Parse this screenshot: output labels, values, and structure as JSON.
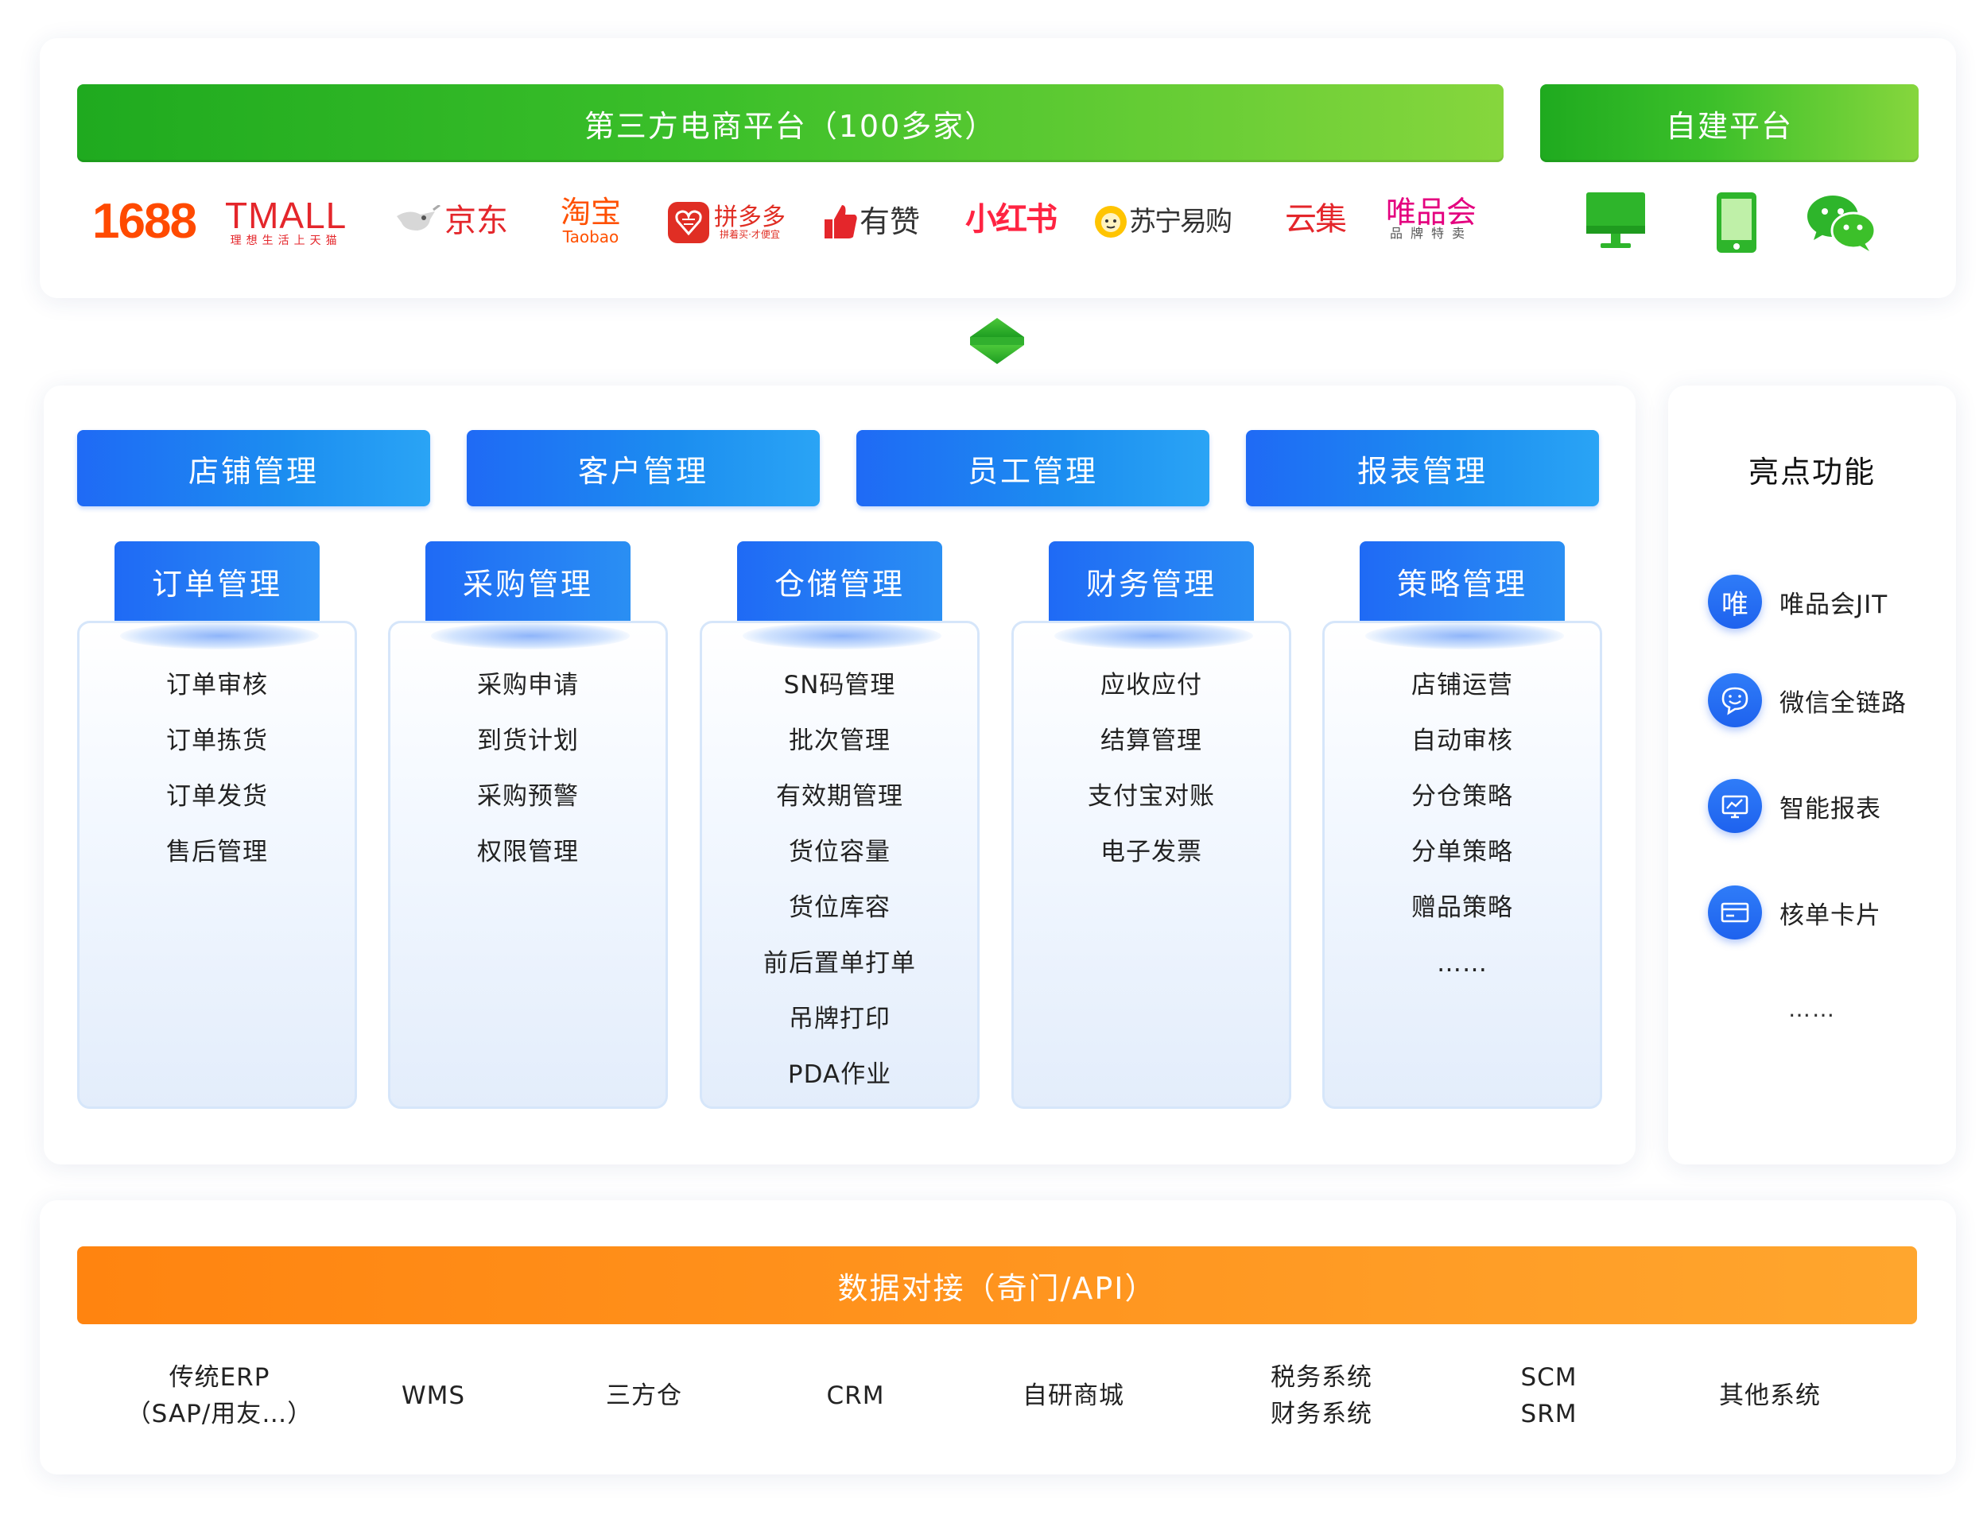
{
  "top": {
    "third_party_title": "第三方电商平台（100多家）",
    "self_built_title": "自建平台",
    "logos": {
      "l1688": "1688",
      "tmall": "TMALL",
      "tmall_sub": "理想生活上天猫",
      "jd": "京东",
      "taobao_cn": "淘宝",
      "taobao_en": "Taobao",
      "pdd": "拼多多",
      "pdd_sub": "拼着买·才便宜",
      "youzan": "有赞",
      "xhs": "小红书",
      "suning": "苏宁易购",
      "yunji": "云集",
      "vip": "唯品会",
      "vip_sub": "品牌特卖"
    },
    "self_icons": [
      "monitor-icon",
      "phone-icon",
      "wechat-icon"
    ]
  },
  "modules": {
    "top_row": [
      "店铺管理",
      "客户管理",
      "员工管理",
      "报表管理"
    ],
    "columns": [
      {
        "title": "订单管理",
        "items": [
          "订单审核",
          "订单拣货",
          "订单发货",
          "售后管理"
        ]
      },
      {
        "title": "采购管理",
        "items": [
          "采购申请",
          "到货计划",
          "采购预警",
          "权限管理"
        ]
      },
      {
        "title": "仓储管理",
        "items": [
          "SN码管理",
          "批次管理",
          "有效期管理",
          "货位容量",
          "货位库容",
          "前后置单打单",
          "吊牌打印",
          "PDA作业"
        ]
      },
      {
        "title": "财务管理",
        "items": [
          "应收应付",
          "结算管理",
          "支付宝对账",
          "电子发票"
        ]
      },
      {
        "title": "策略管理",
        "items": [
          "店铺运营",
          "自动审核",
          "分仓策略",
          "分单策略",
          "赠品策略",
          "……"
        ]
      }
    ]
  },
  "highlights": {
    "title": "亮点功能",
    "items": [
      {
        "label": "唯品会JIT",
        "icon": "vip-icon",
        "glyph": "唯"
      },
      {
        "label": "微信全链路",
        "icon": "chat-icon"
      },
      {
        "label": "智能报表",
        "icon": "report-icon"
      },
      {
        "label": "核单卡片",
        "icon": "card-icon"
      }
    ],
    "ellipsis": "……"
  },
  "bottom": {
    "title": "数据对接（奇门/API）",
    "systems": [
      {
        "lines": [
          "传统ERP",
          "（SAP/用友…）"
        ]
      },
      {
        "lines": [
          "WMS"
        ]
      },
      {
        "lines": [
          "三方仓"
        ]
      },
      {
        "lines": [
          "CRM"
        ]
      },
      {
        "lines": [
          "自研商城"
        ]
      },
      {
        "lines": [
          "税务系统",
          "财务系统"
        ]
      },
      {
        "lines": [
          "SCM",
          "SRM"
        ]
      },
      {
        "lines": [
          "其他系统"
        ]
      }
    ]
  },
  "colors": {
    "green": "#2db52a",
    "blue": "#1f6af5",
    "orange": "#ff8c16",
    "logo_red": "#e4262b",
    "logo_orange": "#ff5000"
  }
}
